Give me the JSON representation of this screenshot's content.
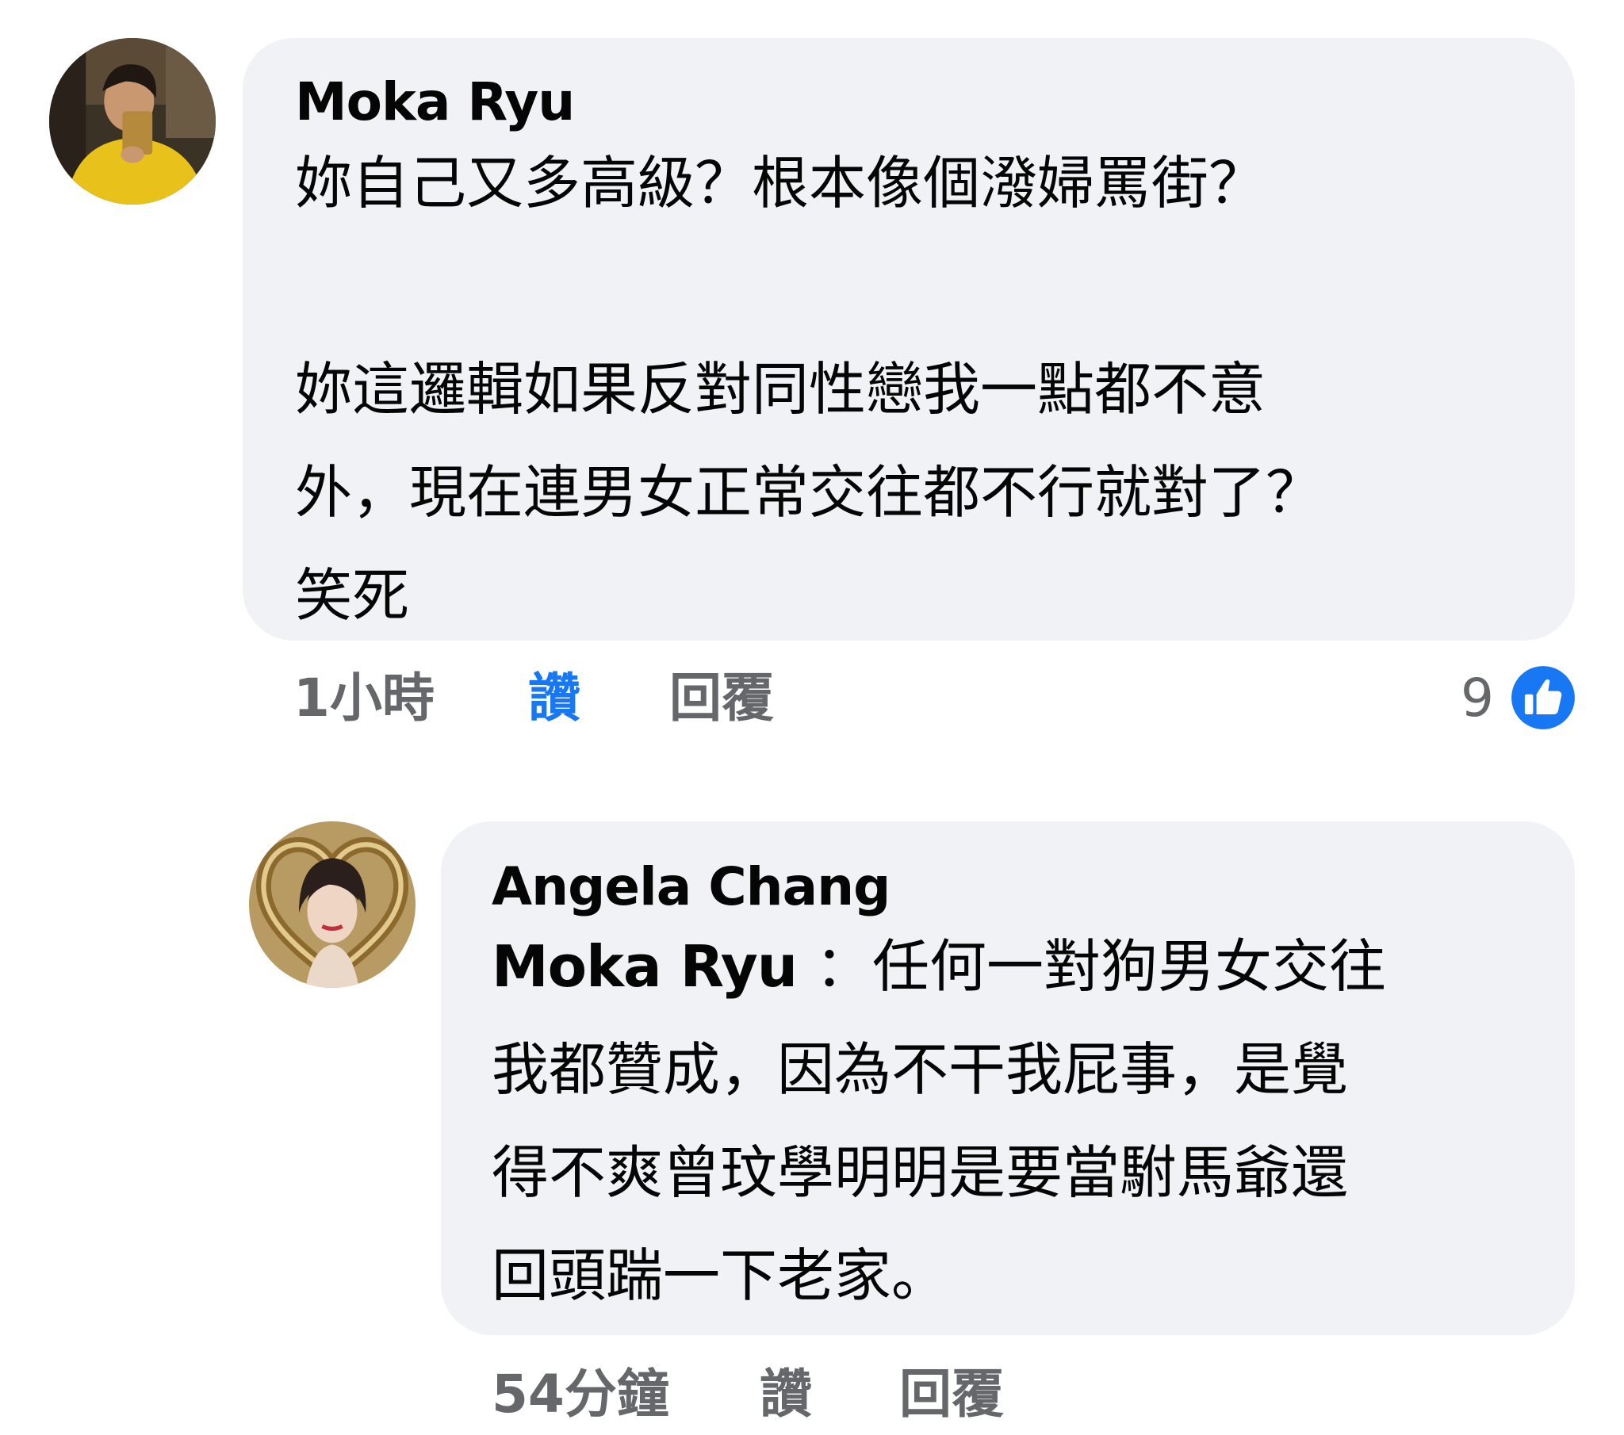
{
  "comments": [
    {
      "author": "Moka Ryu",
      "text": "妳自己又多高級？根本像個潑婦罵街？\n\n妳這邏輯如果反對同性戀我一點都不意\n外，現在連男女正常交往都不行就對了？\n笑死",
      "time": "1小時",
      "like_label": "讚",
      "reply_label": "回覆",
      "reaction_count": "9",
      "reaction_icon": "like-icon",
      "liked_color": "#1877f2",
      "replies": [
        {
          "author": "Angela Chang",
          "mention": "Moka Ryu",
          "text": "：任何一對狗男女交往\n我都贊成，因為不干我屁事，是覺\n得不爽曾玟學明明是要當駙馬爺還\n回頭踹一下老家。",
          "time": "54分鐘",
          "like_label": "讚",
          "reply_label": "回覆"
        }
      ]
    }
  ],
  "colors": {
    "bubble": "#f0f2f5",
    "text": "#050505",
    "meta": "#65676b",
    "accent": "#1877f2"
  }
}
